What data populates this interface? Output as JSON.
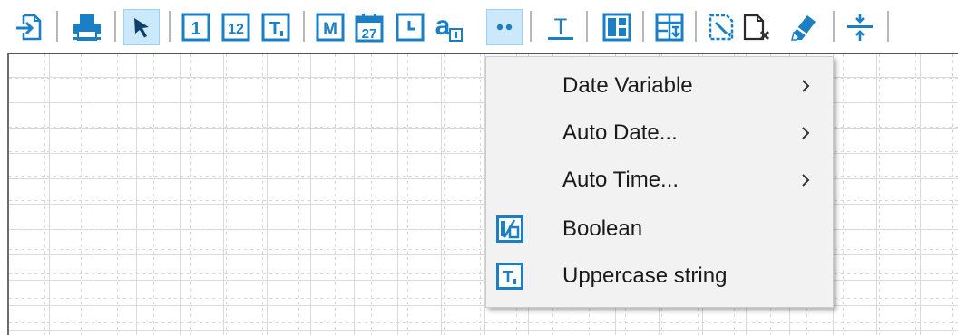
{
  "toolbar": {
    "buttons": [
      {
        "name": "import-icon"
      },
      {
        "name": "print-icon"
      },
      {
        "name": "pointer-icon",
        "active": true
      },
      {
        "name": "integer-field-icon",
        "text": "1"
      },
      {
        "name": "number-field-icon",
        "text": "12"
      },
      {
        "name": "text-field-icon",
        "text": "T"
      },
      {
        "name": "memo-field-icon",
        "text": "M"
      },
      {
        "name": "date-field-icon",
        "text": "27"
      },
      {
        "name": "time-field-icon"
      },
      {
        "name": "function-field-icon",
        "text": "a"
      },
      {
        "name": "more-fields-icon",
        "active": true
      },
      {
        "name": "label-icon",
        "text": "T"
      },
      {
        "name": "panel-icon"
      },
      {
        "name": "subreport-icon"
      },
      {
        "name": "page-setup-icon"
      },
      {
        "name": "delete-page-icon"
      },
      {
        "name": "eraser-icon"
      },
      {
        "name": "vertical-space-icon"
      }
    ]
  },
  "menu": {
    "items": [
      {
        "label": "Date Variable",
        "submenu": true
      },
      {
        "label": "Auto Date...",
        "submenu": true
      },
      {
        "label": "Auto Time...",
        "submenu": true
      },
      {
        "label": "Boolean",
        "icon": "boolean-icon",
        "icon_text": "1/0"
      },
      {
        "label": "Uppercase string",
        "icon": "uppercase-string-icon",
        "icon_text": "T"
      }
    ]
  },
  "colors": {
    "accent": "#1a7fc4",
    "active_bg": "#cce8fb",
    "menu_bg": "#f2f2f2"
  }
}
